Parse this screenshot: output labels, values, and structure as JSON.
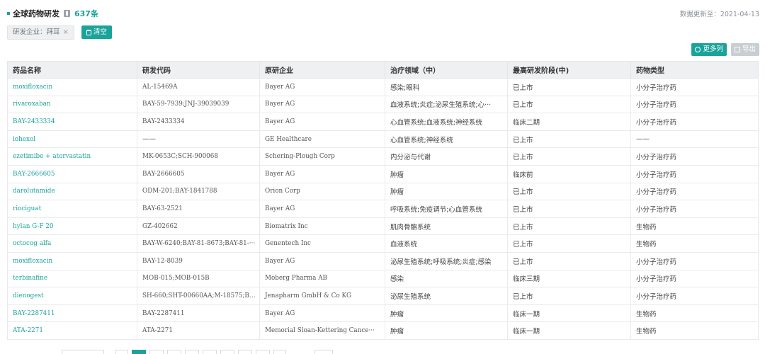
{
  "header": {
    "title": "全球药物研发",
    "count": "637条",
    "update_text": "数据更新至：2021-04-13"
  },
  "filter": {
    "tag_label": "研发企业：拜耳",
    "tag_close": "×",
    "clear_label": "清空"
  },
  "toolbar": {
    "more_columns_label": "更多列",
    "export_label": "导出"
  },
  "table": {
    "columns": [
      "药品名称",
      "研发代码",
      "原研企业",
      "治疗领域（中）",
      "最高研发阶段(中)",
      "药物类型"
    ],
    "rows": [
      [
        "moxifloxacin",
        "AL-15469A",
        "Bayer AG",
        "感染;眼科",
        "已上市",
        "小分子治疗药"
      ],
      [
        "rivaroxaban",
        "BAY-59-7939;JNJ-39039039",
        "Bayer AG",
        "血液系统;炎症;泌尿生殖系统;心···",
        "已上市",
        "小分子治疗药"
      ],
      [
        "BAY-2433334",
        "BAY-2433334",
        "Bayer AG",
        "心血管系统;血液系统;神经系统",
        "临床二期",
        "小分子治疗药"
      ],
      [
        "iohexol",
        "——",
        "GE Healthcare",
        "心血管系统;神经系统",
        "已上市",
        "——"
      ],
      [
        "ezetimibe + atorvastatin",
        "MK-0653C;SCH-900068",
        "Schering-Plough Corp",
        "内分泌与代谢",
        "已上市",
        "小分子治疗药"
      ],
      [
        "BAY-2666605",
        "BAY-2666605",
        "Bayer AG",
        "肿瘤",
        "临床前",
        "小分子治疗药"
      ],
      [
        "darolutamide",
        "ODM-201;BAY-1841788",
        "Orion Corp",
        "肿瘤",
        "已上市",
        "小分子治疗药"
      ],
      [
        "riociguat",
        "BAY-63-2521",
        "Bayer AG",
        "呼吸系统;免疫调节;心血管系统",
        "已上市",
        "小分子治疗药"
      ],
      [
        "hylan G-F 20",
        "GZ-402662",
        "Biomatrix Inc",
        "肌肉骨骼系统",
        "已上市",
        "生物药"
      ],
      [
        "octocog alfa",
        "BAY-W-6240;BAY-81-8673;BAY-81-···",
        "Genentech Inc",
        "血液系统",
        "已上市",
        "生物药"
      ],
      [
        "moxifloxacin",
        "BAY-12-8039",
        "Bayer AG",
        "泌尿生殖系统;呼吸系统;炎症;感染",
        "已上市",
        "小分子治疗药"
      ],
      [
        "terbinafine",
        "MOB-015;MOB-015B",
        "Moberg Pharma AB",
        "感染",
        "临床三期",
        "小分子治疗药"
      ],
      [
        "dienogest",
        "SH-660;SHT-00660AA;M-18575;BAY···",
        "Jenapharm GmbH & Co KG",
        "泌尿生殖系统",
        "已上市",
        "小分子治疗药"
      ],
      [
        "BAY-2287411",
        "BAY-2287411",
        "Bayer AG",
        "肿瘤",
        "临床一期",
        "生物药"
      ],
      [
        "ATA-2271",
        "ATA-2271",
        "Memorial Sloan-Kettering Cance···",
        "肿瘤",
        "临床一期",
        "生物药"
      ]
    ]
  },
  "colors": {
    "accent": "#1aa39a",
    "header_bg": "#eef0f2"
  }
}
